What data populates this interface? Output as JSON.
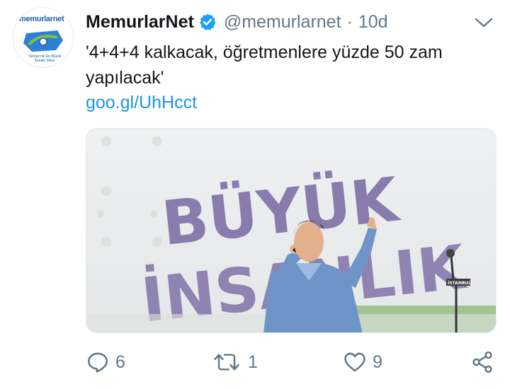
{
  "tweet": {
    "avatar_brand": "memurlarnet",
    "avatar_tagline": "Türkiye'nin En Büyük Sendik Sitesi",
    "display_name": "MemurlarNet",
    "handle": "@memurlarnet",
    "separator": "·",
    "time": "10d",
    "text": "'4+4+4 kalkacak, öğretmenlere yüzde 50 zam yapılacak'",
    "link": "goo.gl/UhHcct",
    "media": {
      "banner_line1": "BÜYÜK",
      "banner_line2": "İNSANLIK",
      "podium_label": "İSTANBUL"
    }
  },
  "actions": {
    "reply_count": "6",
    "retweet_count": "1",
    "like_count": "9"
  },
  "colors": {
    "link": "#1b95e0",
    "verified": "#1da1f2",
    "muted": "#657786",
    "banner_text": "#6d5d9c"
  }
}
